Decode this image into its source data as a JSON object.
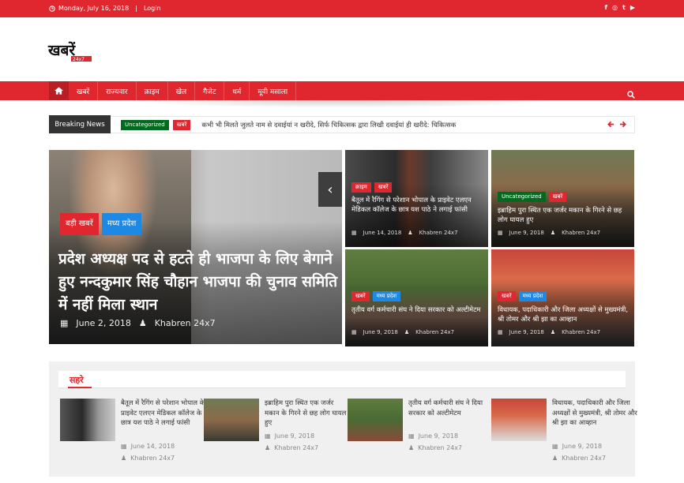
{
  "topbar": {
    "date": "Monday, July 16, 2018",
    "login": "Login",
    "social": [
      "f",
      "◎",
      "t",
      "▶"
    ]
  },
  "logo": {
    "main": "खबरें",
    "sub": "24x7"
  },
  "nav": {
    "items": [
      "खबरें",
      "राज्यवार",
      "क्राइम",
      "खेल",
      "गैजेट",
      "धर्म",
      "मूवी मसाला"
    ]
  },
  "breaking": {
    "label": "Breaking News",
    "badge1": "Uncategorized",
    "badge2": "खबरें",
    "text": "कभी भी मिलते जुलते नाम से दवाईयां न खरीदे, सिर्फ चिकित्सक द्वारा लिखी दवाईयां ही खरीदे: चिकित्सक"
  },
  "hero": {
    "badge1": "बड़ी खबरें",
    "badge2": "मध्य प्रदेश",
    "title": "प्रदेश अध्यक्ष पद से हटते ही भाजपा के लिए बेगाने हुए नन्दकुमार सिंह चौहान भाजपा की चुनाव समिति में नहीं मिला स्थान",
    "date": "June 2, 2018",
    "author": "Khabren 24x7"
  },
  "tiles": [
    {
      "badge1": "क्राइम",
      "badge2": "खबरें",
      "title": "बैतूल में रैगिंग से परेशान भोपाल के प्राइवेट एलएन मेडिकल कॉलेज के छात्र यश पाठे ने लगाई फांसी",
      "date": "June 14, 2018",
      "author": "Khabren 24x7"
    },
    {
      "badge1": "Uncategorized",
      "badge2": "खबरें",
      "title": "इब्राहिम पुरा स्थित एक जर्जर मकान के गिरने से छह लोग घायल हुए",
      "date": "June 9, 2018",
      "author": "Khabren 24x7"
    },
    {
      "badge1": "खबरें",
      "badge2": "मध्य प्रदेश",
      "title": "तृतीय वर्ग कर्मचारी संघ ने दिया सरकार को अल्टीमेटम",
      "date": "June 9, 2018",
      "author": "Khabren 24x7"
    },
    {
      "badge1": "खबरें",
      "badge2": "मध्य प्रदेश",
      "title": "विधायक, पदाधिकारी और जिला अध्यक्षों से मुख्यमंत्री, श्री तोमर और श्री झा का आव्हान",
      "date": "June 9, 2018",
      "author": "Khabren 24x7"
    }
  ],
  "section": {
    "title": "सहरे",
    "cards": [
      {
        "title": "बैतूल में रैगिंग से परेशान भोपाल के प्राइवेट एलएन मेडिकल कॉलेज के छात्र यश पाठे ने लगाई फांसी",
        "date": "June 14, 2018",
        "author": "Khabren 24x7"
      },
      {
        "title": "इब्राहिम पुरा स्थित एक जर्जर मकान के गिरने से छह लोग घायल हुए",
        "date": "June 9, 2018",
        "author": "Khabren 24x7"
      },
      {
        "title": "तृतीय वर्ग कर्मचारी संघ ने दिया सरकार को अल्टीमेटम",
        "date": "June 9, 2018",
        "author": "Khabren 24x7"
      },
      {
        "title": "विधायक, पदाधिकारी और जिला अध्यक्षों से मुख्यमंत्री, श्री तोमर और श्री झा का आव्हान",
        "date": "June 9, 2018",
        "author": "Khabren 24x7"
      }
    ]
  },
  "colors": {
    "brand": "#e0272f",
    "badge_green": "#006b1e",
    "badge_blue": "#1e88e5"
  }
}
